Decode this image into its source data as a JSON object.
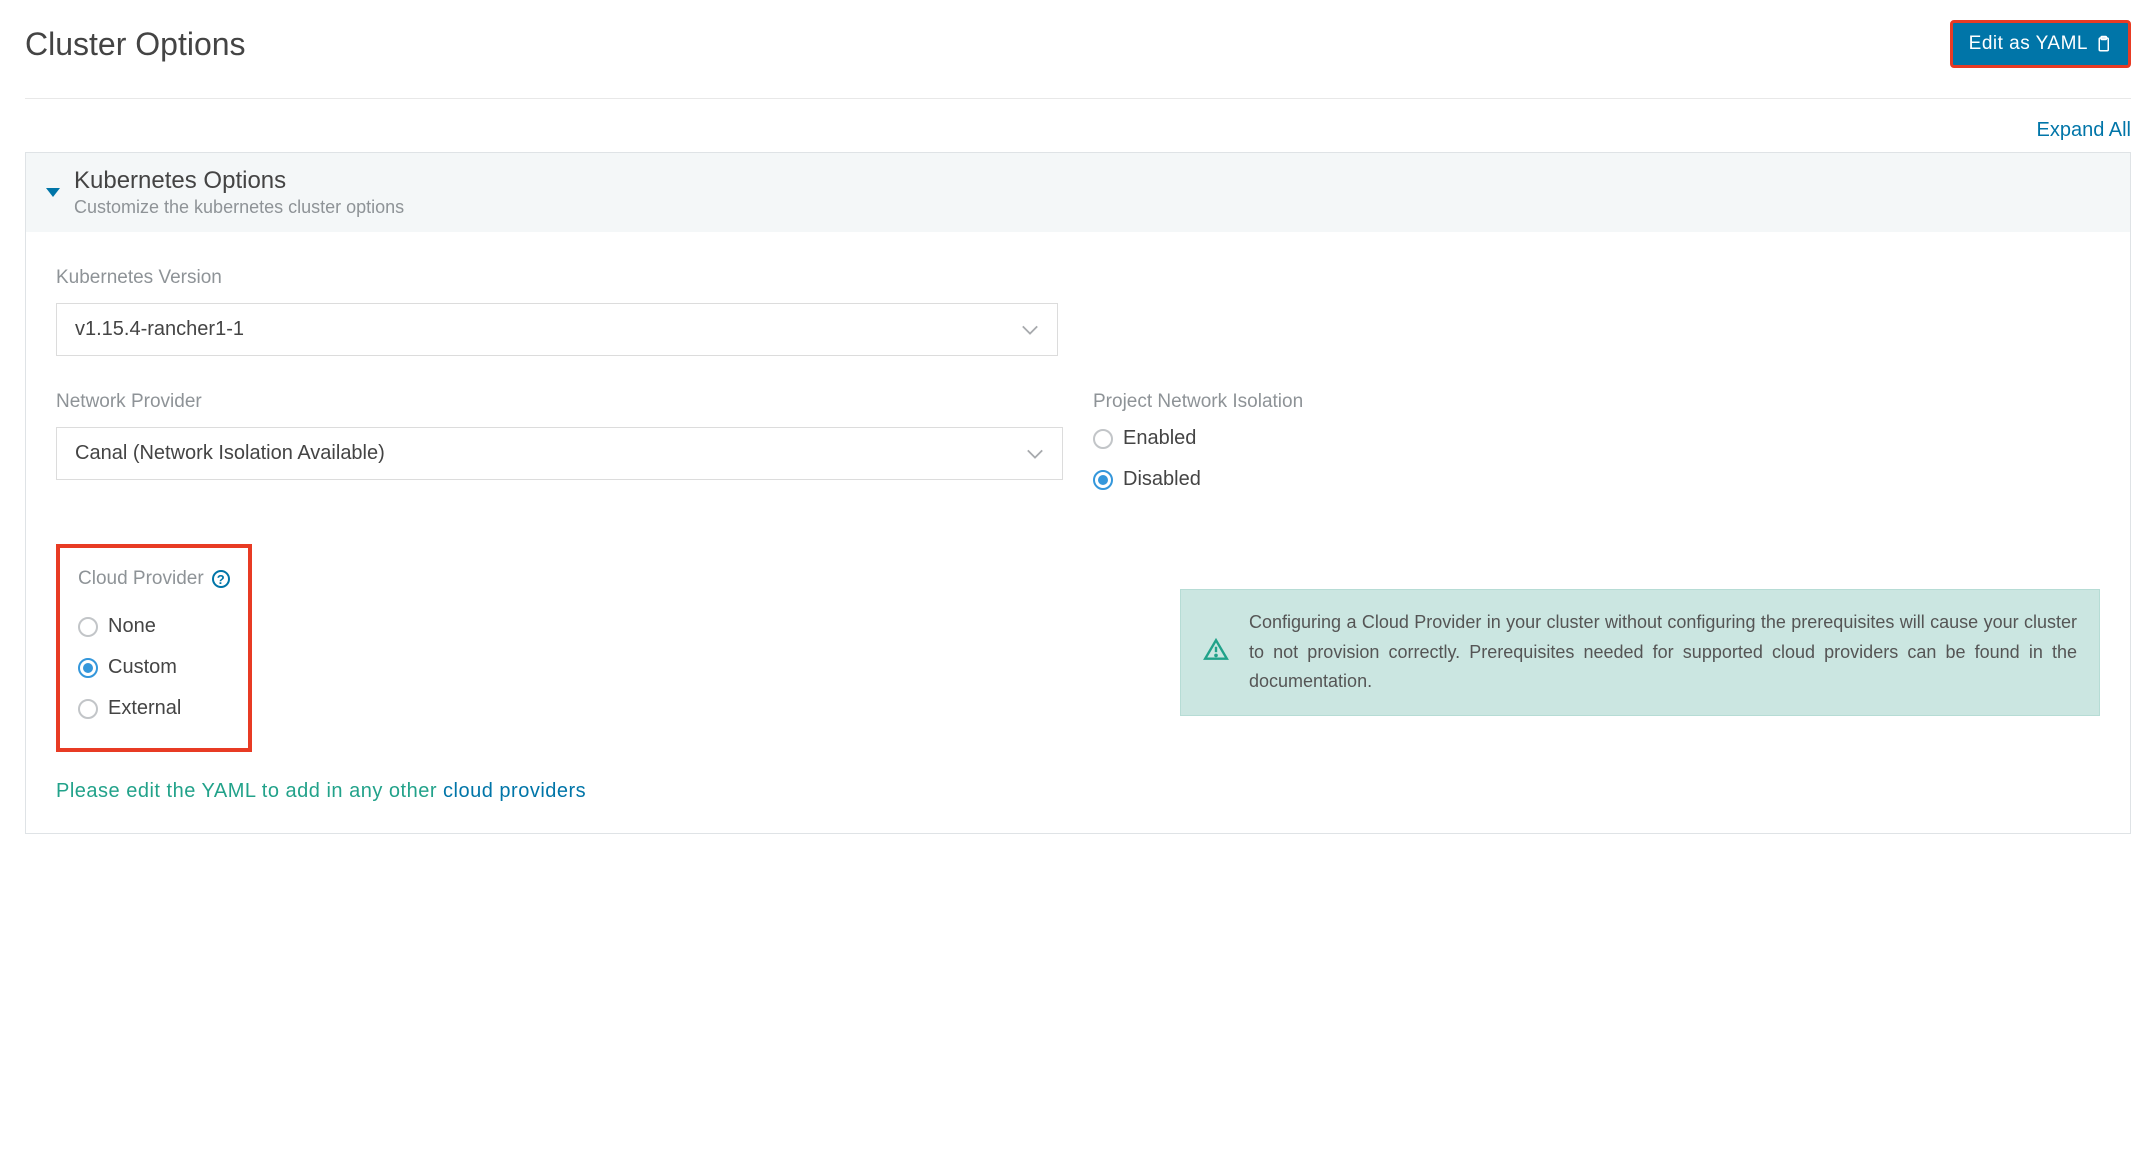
{
  "header": {
    "title": "Cluster Options",
    "edit_yaml_label": "Edit as YAML"
  },
  "actions": {
    "expand_all": "Expand All"
  },
  "kubernetes": {
    "section_title": "Kubernetes Options",
    "section_subtitle": "Customize the kubernetes cluster options",
    "version_label": "Kubernetes Version",
    "version_value": "v1.15.4-rancher1-1",
    "network_provider_label": "Network Provider",
    "network_provider_value": "Canal (Network Isolation Available)",
    "network_isolation_label": "Project Network Isolation",
    "isolation_options": {
      "enabled": "Enabled",
      "disabled": "Disabled"
    },
    "isolation_selected": "Disabled",
    "cloud_provider_label": "Cloud Provider",
    "cloud_provider_options": {
      "none": "None",
      "custom": "Custom",
      "external": "External"
    },
    "cloud_provider_selected": "Custom",
    "cloud_alert": "Configuring a Cloud Provider in your cluster without configuring the prerequisites will cause your cluster to not provision correctly. Prerequisites needed for supported cloud providers can be found in the documentation.",
    "yaml_hint_prefix": "Please edit the YAML to add in any other ",
    "yaml_hint_link": "cloud providers"
  }
}
